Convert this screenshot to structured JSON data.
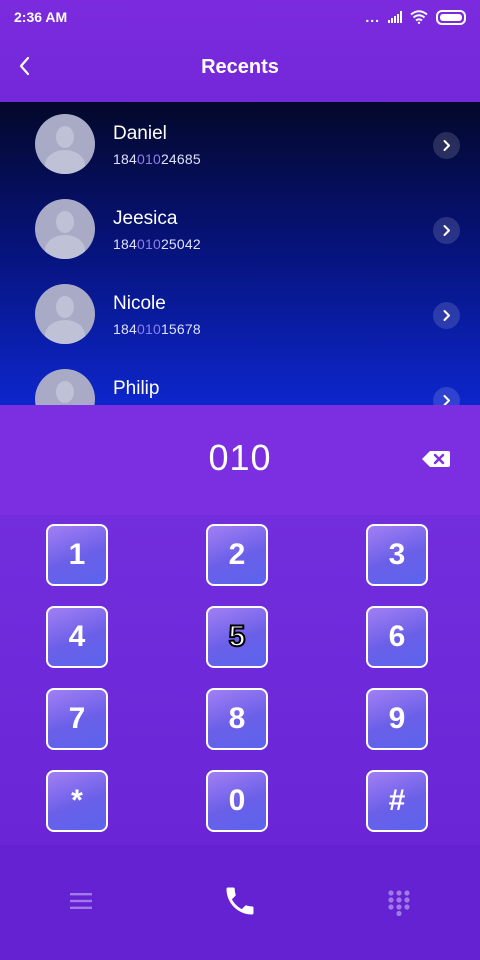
{
  "status": {
    "time": "2:36 AM",
    "more": "..."
  },
  "header": {
    "title": "Recents"
  },
  "recents": [
    {
      "name": "Daniel",
      "number_pre": "184",
      "number_match": "010",
      "number_post": "24685"
    },
    {
      "name": "Jeesica",
      "number_pre": "184",
      "number_match": "010",
      "number_post": "25042"
    },
    {
      "name": "Nicole",
      "number_pre": "184",
      "number_match": "010",
      "number_post": "15678"
    },
    {
      "name": "Philip",
      "number_pre": "",
      "number_match": "",
      "number_post": ""
    }
  ],
  "dialer": {
    "entered_number": "010"
  },
  "keypad": {
    "keys": [
      "1",
      "2",
      "3",
      "4",
      "5",
      "6",
      "7",
      "8",
      "9",
      "*",
      "0",
      "#"
    ]
  },
  "bottom_nav": {
    "items": [
      "menu-icon",
      "phone-icon",
      "keypad-icon"
    ]
  }
}
